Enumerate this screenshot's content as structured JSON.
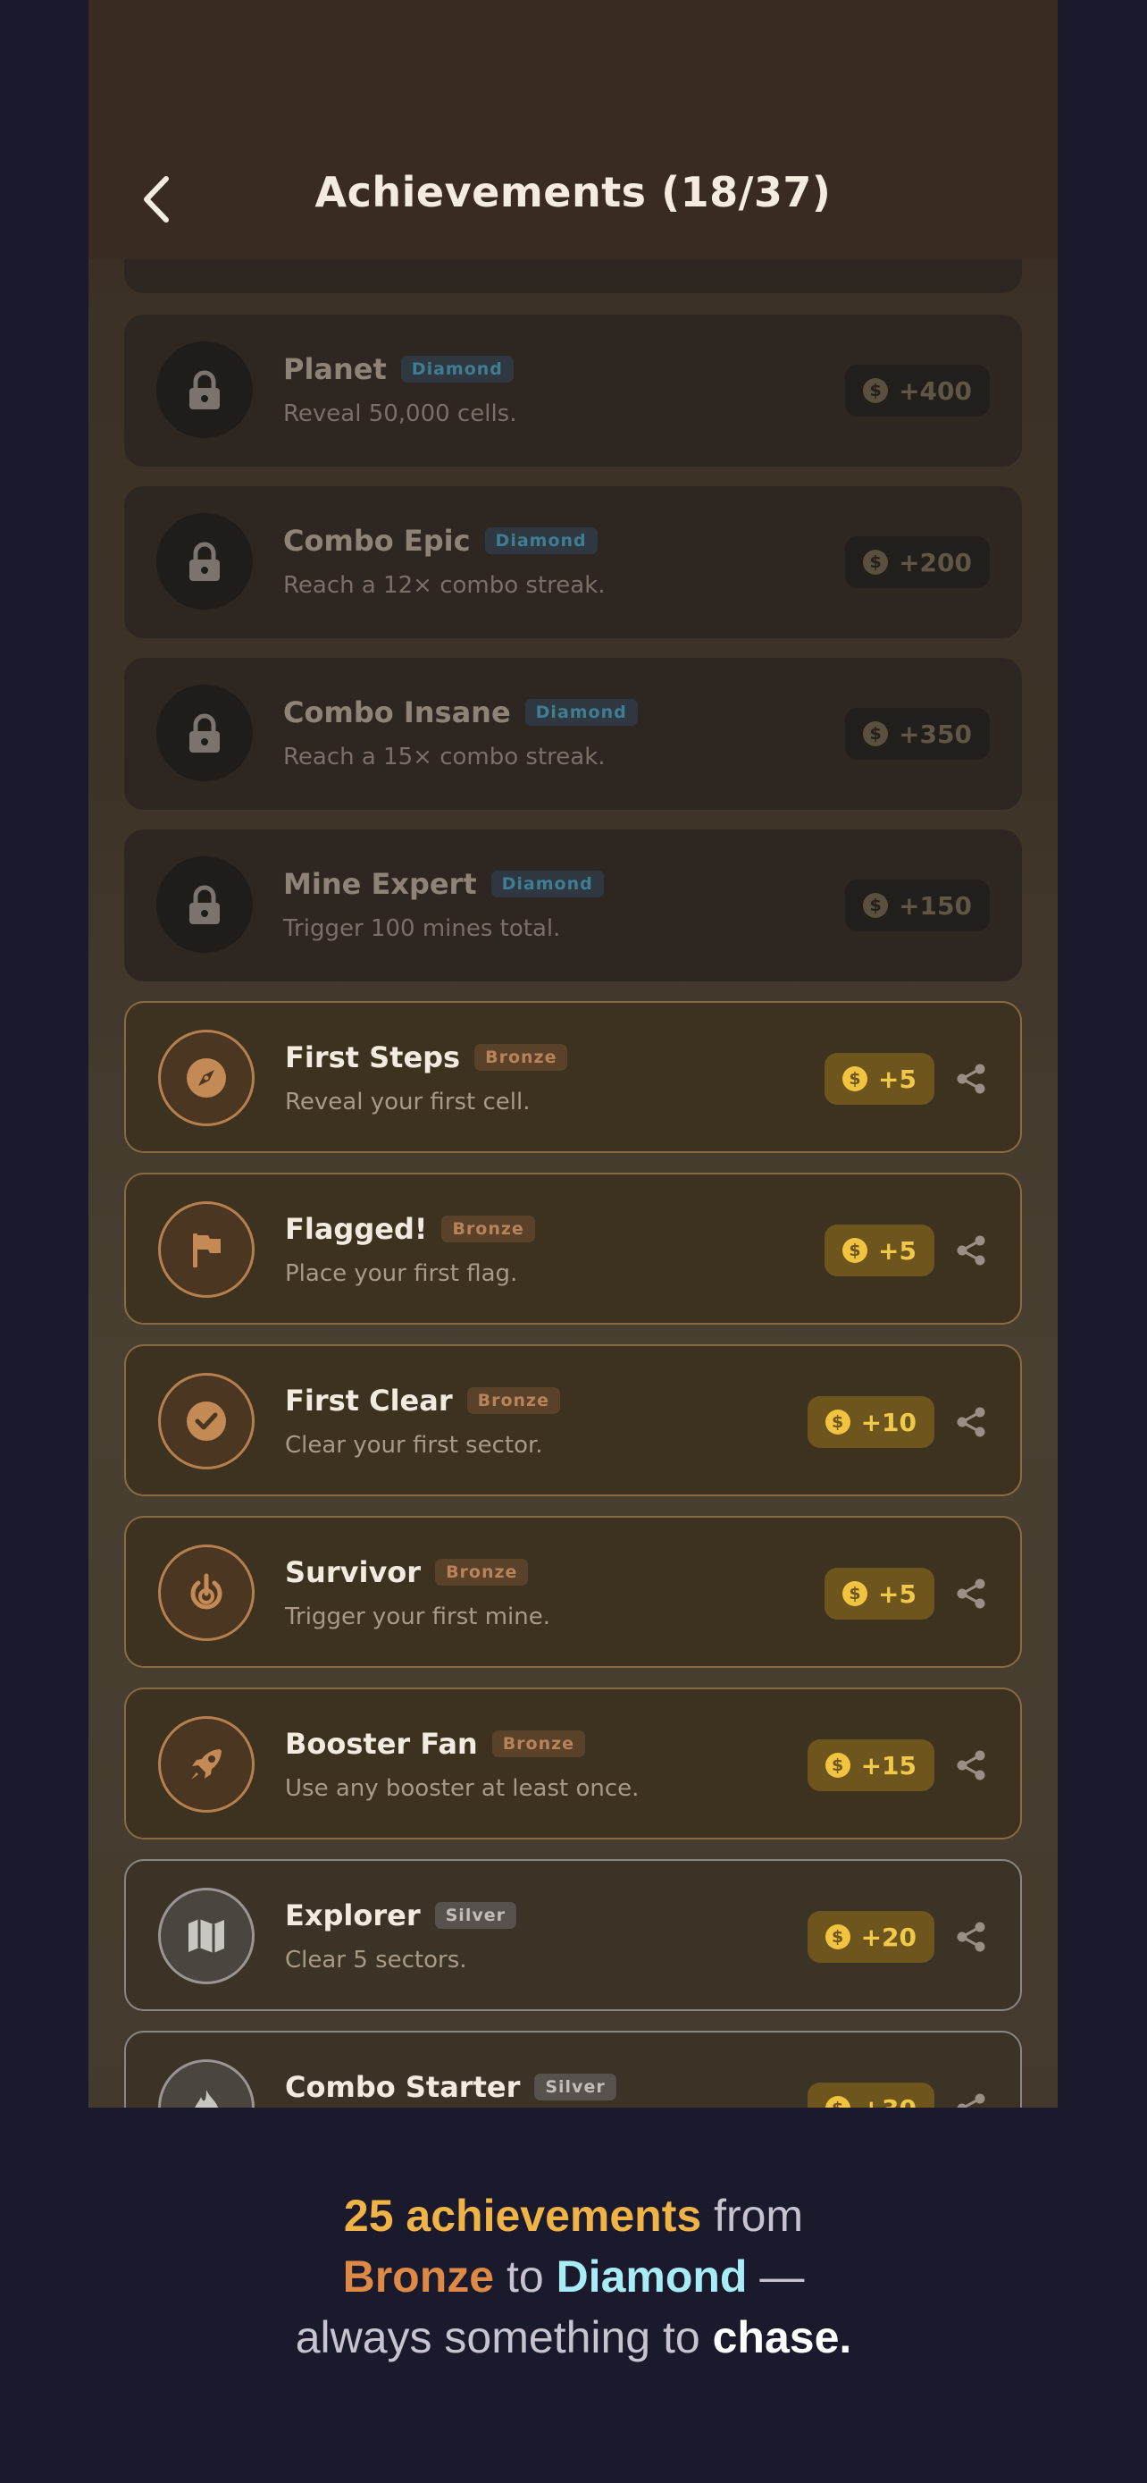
{
  "header": {
    "title": "Achievements (18/37)",
    "back_icon": "chevron-left-icon"
  },
  "colors": {
    "gold": "#f0b346",
    "bronze": "#dc8a45",
    "diamond": "#a8ecf8",
    "background": "#1b1a2c"
  },
  "achievements": [
    {
      "name": "Planet",
      "tier": "Diamond",
      "desc": "Reveal 50,000 cells.",
      "reward": "+400",
      "locked": true,
      "icon": "lock-icon"
    },
    {
      "name": "Combo Epic",
      "tier": "Diamond",
      "desc": "Reach a 12× combo streak.",
      "reward": "+200",
      "locked": true,
      "icon": "lock-icon"
    },
    {
      "name": "Combo Insane",
      "tier": "Diamond",
      "desc": "Reach a 15× combo streak.",
      "reward": "+350",
      "locked": true,
      "icon": "lock-icon"
    },
    {
      "name": "Mine Expert",
      "tier": "Diamond",
      "desc": "Trigger 100 mines total.",
      "reward": "+150",
      "locked": true,
      "icon": "lock-icon"
    },
    {
      "name": "First Steps",
      "tier": "Bronze",
      "desc": "Reveal your first cell.",
      "reward": "+5",
      "locked": false,
      "icon": "compass-icon"
    },
    {
      "name": "Flagged!",
      "tier": "Bronze",
      "desc": "Place your first flag.",
      "reward": "+5",
      "locked": false,
      "icon": "flag-icon"
    },
    {
      "name": "First Clear",
      "tier": "Bronze",
      "desc": "Clear your first sector.",
      "reward": "+10",
      "locked": false,
      "icon": "check-circle-icon"
    },
    {
      "name": "Survivor",
      "tier": "Bronze",
      "desc": "Trigger your first mine.",
      "reward": "+5",
      "locked": false,
      "icon": "power-icon"
    },
    {
      "name": "Booster Fan",
      "tier": "Bronze",
      "desc": "Use any booster at least once.",
      "reward": "+15",
      "locked": false,
      "icon": "rocket-icon"
    },
    {
      "name": "Explorer",
      "tier": "Silver",
      "desc": "Clear 5 sectors.",
      "reward": "+20",
      "locked": false,
      "icon": "map-icon"
    },
    {
      "name": "Combo Starter",
      "tier": "Silver",
      "desc": "",
      "reward": "+30",
      "locked": false,
      "icon": "flame-icon"
    }
  ],
  "caption": {
    "p1": "25 achievements",
    "p2": " from",
    "p3": "Bronze",
    "p4": " to ",
    "p5": "Diamond",
    "p6": " —",
    "p7": "always something to ",
    "p8": "chase."
  }
}
